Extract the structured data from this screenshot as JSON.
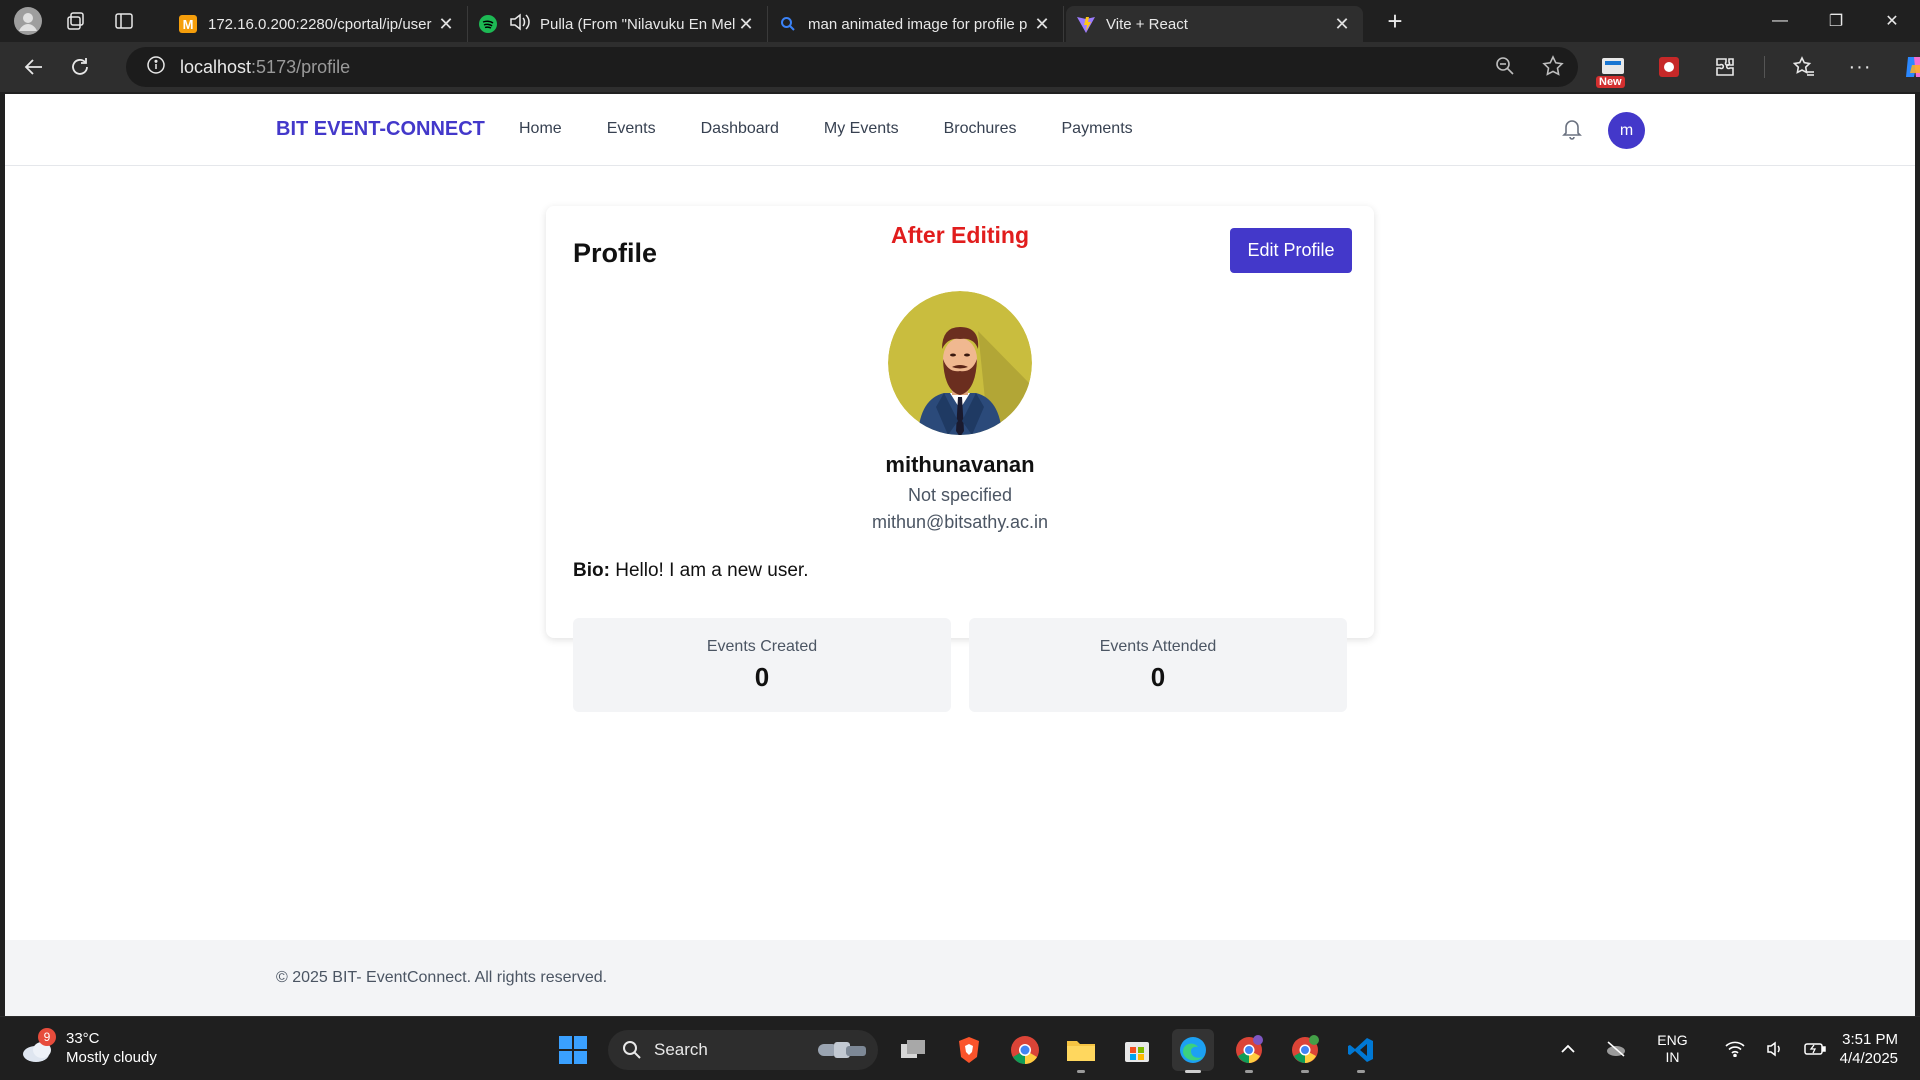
{
  "browser": {
    "tabs": [
      {
        "title": "172.16.0.200:2280/cportal/ip/user",
        "favicon": "portal-icon",
        "active": false
      },
      {
        "title": "Pulla (From \"Nilavuku En Mel",
        "favicon": "spotify-icon",
        "active": false
      },
      {
        "title": "man animated image for profile p",
        "favicon": "search-icon",
        "active": false
      },
      {
        "title": "Vite + React",
        "favicon": "vite-icon",
        "active": true
      }
    ],
    "address": {
      "host": "localhost",
      "path": ":5173/profile"
    },
    "extension_badge": "New"
  },
  "app": {
    "brand": "BIT EVENT-CONNECT",
    "nav": [
      "Home",
      "Events",
      "Dashboard",
      "My Events",
      "Brochures",
      "Payments"
    ],
    "avatar_initial": "m",
    "profile": {
      "title": "Profile",
      "annotation": "After Editing",
      "edit_button": "Edit Profile",
      "name": "mithunavanan",
      "department": "Not specified",
      "email": "mithun@bitsathy.ac.in",
      "bio_label": "Bio:",
      "bio": "Hello! I am a new user.",
      "stats": [
        {
          "label": "Events Created",
          "value": "0"
        },
        {
          "label": "Events Attended",
          "value": "0"
        }
      ]
    },
    "footer": "© 2025 BIT- EventConnect. All rights reserved."
  },
  "taskbar": {
    "weather": {
      "badge": "9",
      "temp": "33°C",
      "condition": "Mostly cloudy"
    },
    "search_label": "Search",
    "lang": {
      "line1": "ENG",
      "line2": "IN"
    },
    "clock": {
      "time": "3:51 PM",
      "date": "4/4/2025"
    }
  },
  "colors": {
    "brand": "#4338ca",
    "annotation": "#e11d1d"
  }
}
